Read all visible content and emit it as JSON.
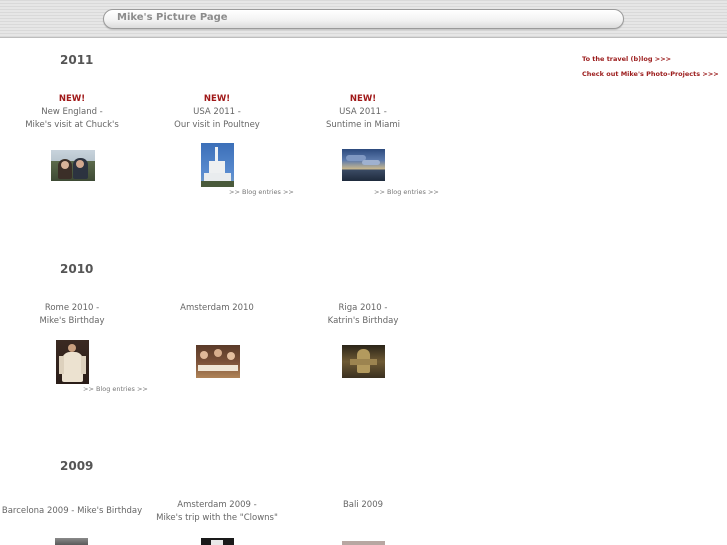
{
  "page": {
    "title": "Mike's Picture Page"
  },
  "side_links": {
    "travel": "To the travel (b)log >>>",
    "projects": "Check out Mike's Photo-Projects >>>"
  },
  "years": [
    {
      "year": "2011",
      "albums": [
        {
          "new": "NEW!",
          "line1": "New England -",
          "line2": "Mike's visit at Chuck's",
          "thumb": "two-people-selfie"
        },
        {
          "new": "NEW!",
          "line1": "USA 2011 -",
          "line2": "Our visit in Poultney",
          "thumb": "white-church-blue-sky",
          "blog": ">> Blog entries >>"
        },
        {
          "new": "NEW!",
          "line1": "USA 2011 -",
          "line2": "Suntime in Miami",
          "thumb": "sunset-over-water",
          "blog": ">> Blog entries >>"
        }
      ]
    },
    {
      "year": "2010",
      "albums": [
        {
          "line1": "Rome 2010 -",
          "line2": "Mike's Birthday",
          "thumb": "person-in-white-dress",
          "blog": ">> Blog entries >>"
        },
        {
          "line1": "Amsterdam 2010",
          "thumb": "people-at-table"
        },
        {
          "line1": "Riga 2010 -",
          "line2": "Katrin's Birthday",
          "thumb": "stone-sculpture"
        }
      ]
    },
    {
      "year": "2009",
      "albums": [
        {
          "line1": "Barcelona 2009 - Mike's Birthday",
          "thumb": "street-scene"
        },
        {
          "line1": "Amsterdam 2009 -",
          "line2": "Mike's trip with the \"Clowns\"",
          "thumb": "dark-group-photo"
        },
        {
          "line1": "Bali 2009",
          "thumb": "bali-landscape"
        }
      ]
    }
  ]
}
